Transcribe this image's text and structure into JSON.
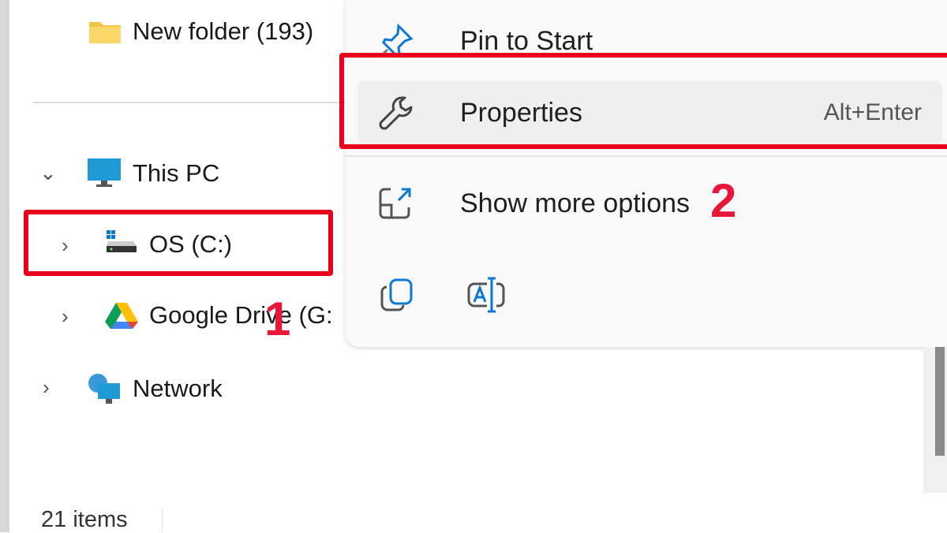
{
  "sidebar": {
    "items": [
      {
        "label": "New folder (193)",
        "icon": "folder-icon"
      },
      {
        "label": "This PC",
        "icon": "monitor-icon",
        "expanded": true
      },
      {
        "label": "OS (C:)",
        "icon": "drive-icon"
      },
      {
        "label": "Google Drive (G:",
        "icon": "google-drive-icon"
      },
      {
        "label": "Network",
        "icon": "network-icon"
      }
    ]
  },
  "context_menu": {
    "items": [
      {
        "label": "Pin to Start",
        "icon": "pin-icon"
      },
      {
        "label": "Properties",
        "shortcut": "Alt+Enter",
        "icon": "wrench-icon"
      },
      {
        "label": "Show more options",
        "icon": "open-external-icon"
      }
    ],
    "bottom_icons": [
      "copy-icon",
      "rename-icon"
    ]
  },
  "annotations": {
    "step1": "1",
    "step2": "2",
    "color": "#e8001c"
  },
  "status": {
    "items": "21 items"
  }
}
